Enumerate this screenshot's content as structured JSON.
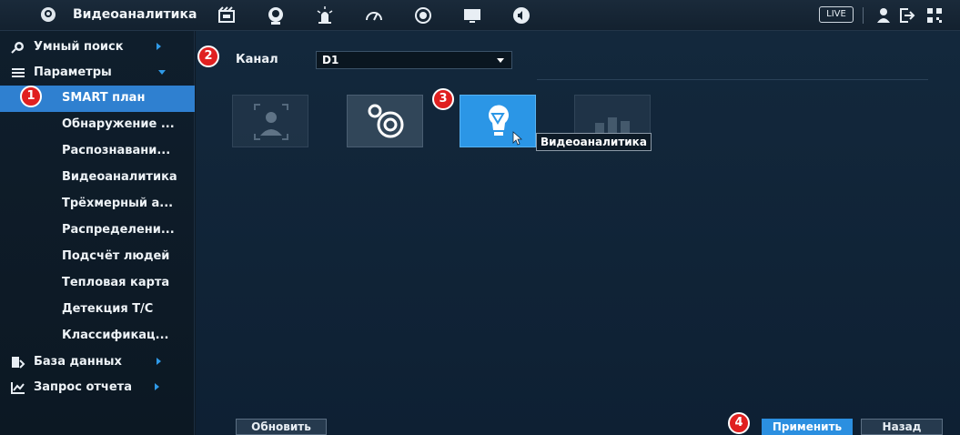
{
  "header": {
    "title": "Видеоаналитика",
    "live_label": "LIVE",
    "icons": [
      "smart-plan-icon",
      "face-icon",
      "alarm-icon",
      "speed-gauge-icon",
      "record-icon",
      "monitor-icon",
      "audio-icon",
      "user-icon",
      "logout-icon",
      "qr-code-icon"
    ]
  },
  "sidebar": {
    "smart_search": "Умный поиск",
    "parameters": "Параметры",
    "sub_items": [
      "SMART план",
      "Обнаружение ...",
      "Распознавани...",
      "Видеоаналитика",
      "Трёхмерный а...",
      "Распределени...",
      "Подсчёт людей",
      "Тепловая карта",
      "Детекция Т/С",
      "Классификац..."
    ],
    "database": "База данных",
    "report_query": "Запрос отчета"
  },
  "main": {
    "channel_label": "Канал",
    "channel_value": "D1",
    "tooltip": "Видеоаналитика",
    "refresh_label": "Обновить",
    "apply_label": "Применить",
    "back_label": "Назад"
  },
  "badges": [
    "1",
    "2",
    "3",
    "4"
  ],
  "colors": {
    "accent": "#2f80d0",
    "selected_tile": "#2b96e6",
    "badge": "#e02020",
    "background": "#0e1a26"
  }
}
